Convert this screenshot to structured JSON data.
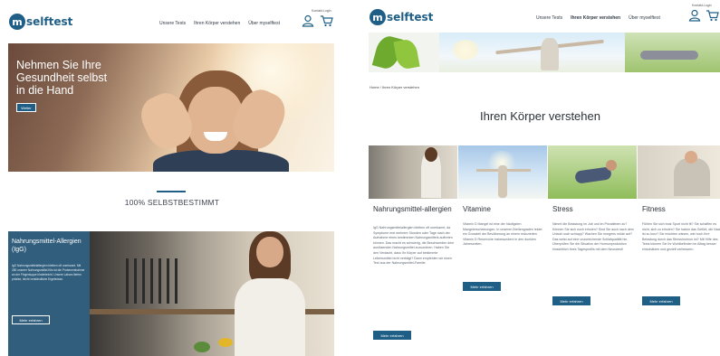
{
  "left": {
    "header": {
      "logo_mark": "m",
      "logo_text": "selftest",
      "nav": [
        "Unsere Tests",
        "Ihren Körper verstehen",
        "Über myselftest"
      ],
      "account_link": "Kontakt-Login",
      "icons": [
        "user-icon",
        "cart-icon"
      ]
    },
    "hero": {
      "title": "Nehmen Sie Ihre Gesundheit selbst in die Hand",
      "button": "Weiter"
    },
    "tagline": "100% SELBSTBESTIMMT",
    "teaser": {
      "title": "Nahrungsmittel-Allergien (IgG)",
      "text": "IgG Nahrungsmittelallergien bleiben oft unerkannt. Mit 280 unserer Nahrungsmittel-Kits ist die Probenentnahme an der Fingerkuppe kinderleicht. Unsere Labors liefern präzise, leicht verständliche Ergebnisse.",
      "button": "Mehr erfahren"
    }
  },
  "right": {
    "header": {
      "logo_mark": "m",
      "logo_text": "selftest",
      "nav": [
        "Unsere Tests",
        "Ihren Körper verstehen",
        "Über myselftest"
      ],
      "active_nav": "Ihren Körper verstehen",
      "account_link": "Kontakt-Login",
      "icons": [
        "user-icon",
        "cart-icon"
      ]
    },
    "breadcrumb": "Home / Ihren Körper verstehen",
    "page_title": "Ihren Körper verstehen",
    "cards": [
      {
        "title": "Nahrungsmittel-allergien",
        "text": "IgG Nahrungsmittelallergien bleiben oft unerkannt, da Symptome erst mehrere Stunden oder Tage nach der Aufnahme eines bestimmten Nahrungsmittels auftreten können. Das macht es schwierig, die Beschwerden dem auslösenden Nahrungsmittel zuzuordnen. Haben Sie den Verdacht, dass Ihr Körper auf bestimmte Lebensmittel nicht verträgt? Dann empfehlen wir einen Test aus der Nahrungsmittel-Familie.",
        "button": "Mehr erfahren"
      },
      {
        "title": "Vitamine",
        "text": "Vitamin D Mangel ist eine der häufigsten Mangelerscheinungen. In unseren Breitengraden leidet ein Grossteil der Bevölkerung an einem reduzierten Vitamin D Reservoire insbesondere in den dunklen Jahreszeiten.",
        "button": "Mehr erfahren"
      },
      {
        "title": "Stress",
        "text": "Nimmt die Belastung im Job und im Privatleben zu? Können Sie sich noch erholen? Sind Sie auch nach dem Urlaub noch schlapp? Wachen Sie morgens müde auf? Das weist auf eine unzureichende Schlafqualität hin. Überprüfen Sie die Situation der Hormonproduktion hinsichtlich Ihres Tagesprofils mit dem Neurotest!",
        "button": "Mehr erfahren"
      },
      {
        "title": "Fitness",
        "text": "Fühlen Sie sich trotz Sport nicht fit? Sie schaffen es nicht, sich zu erholen? Sie haben das Gefühl, die Nacht ist zu kurz? Sie möchten wissen, wie hoch Ihre Belastung durch das Stresshormon ist? Mit Hilfe des Tests können Sie Ihr Wohlbefinden im Alltag besser einschätzen und gezielt verbessern.",
        "button": "Mehr erfahren"
      }
    ]
  },
  "colors": {
    "brand_blue": "#1f5f86",
    "teaser_overlay": "#265677",
    "text_dark": "#2a3238"
  }
}
